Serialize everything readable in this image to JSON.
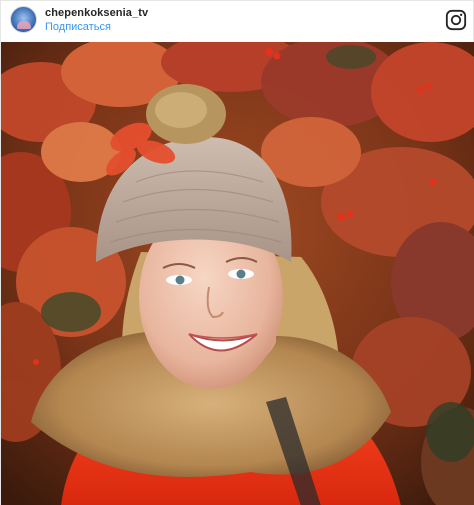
{
  "post": {
    "username": "chepenkoksenia_tv",
    "follow_label": "Подписаться"
  },
  "icons": {
    "avatar": "profile-avatar",
    "brand": "instagram-icon"
  },
  "photo": {
    "subject": "selfie-in-autumn-foliage"
  },
  "colors": {
    "username": "#262626",
    "follow_link": "#3897f0",
    "border": "#e6e6e6"
  }
}
